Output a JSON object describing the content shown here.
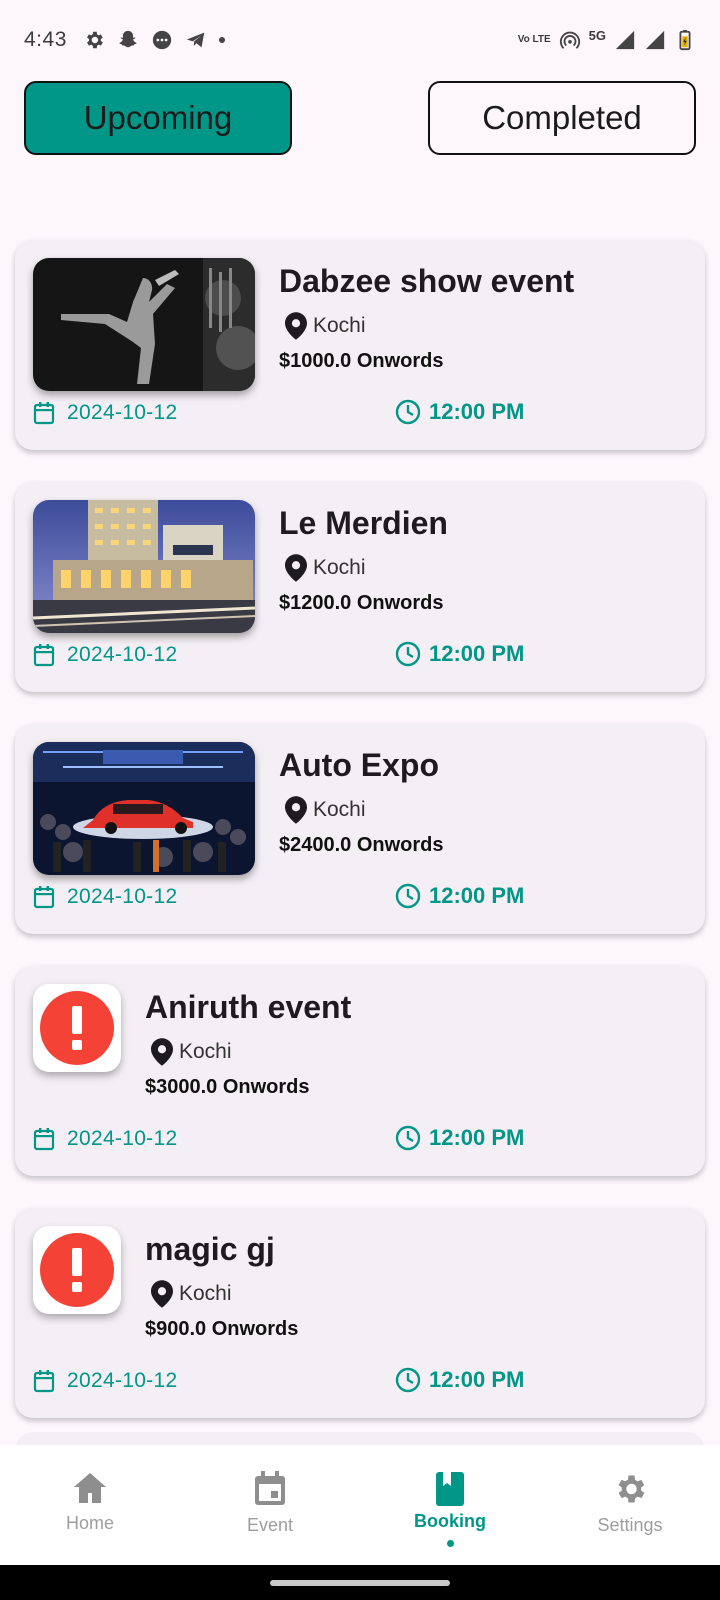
{
  "status_bar": {
    "time": "4:43",
    "network": "5G",
    "volte": "Vo LTE"
  },
  "tabs": {
    "upcoming": "Upcoming",
    "completed": "Completed",
    "active": "Upcoming",
    "active_color": "#009688"
  },
  "events": [
    {
      "title": "Dabzee show event",
      "location": "Kochi",
      "price": "$1000.0 Onwords",
      "date": "2024-10-12",
      "time": "12:00 PM",
      "image": "concert-photo"
    },
    {
      "title": "Le Merdien",
      "location": "Kochi",
      "price": "$1200.0 Onwords",
      "date": "2024-10-12",
      "time": "12:00 PM",
      "image": "hotel-photo"
    },
    {
      "title": "Auto Expo",
      "location": "Kochi",
      "price": "$2400.0 Onwords",
      "date": "2024-10-12",
      "time": "12:00 PM",
      "image": "car-expo-photo"
    },
    {
      "title": "Aniruth event",
      "location": "Kochi",
      "price": "$3000.0 Onwords",
      "date": "2024-10-12",
      "time": "12:00 PM",
      "image": "error-icon"
    },
    {
      "title": "magic gj",
      "location": "Kochi",
      "price": "$900.0 Onwords",
      "date": "2024-10-12",
      "time": "12:00 PM",
      "image": "error-icon"
    }
  ],
  "bottom_nav": {
    "items": [
      {
        "label": "Home",
        "icon": "home-icon"
      },
      {
        "label": "Event",
        "icon": "calendar-icon"
      },
      {
        "label": "Booking",
        "icon": "book-icon"
      },
      {
        "label": "Settings",
        "icon": "gear-icon"
      }
    ],
    "active": "Booking"
  },
  "colors": {
    "accent": "#009688",
    "error": "#f44336",
    "card_bg": "#f4eff4",
    "page_bg": "#fdf7fc"
  }
}
